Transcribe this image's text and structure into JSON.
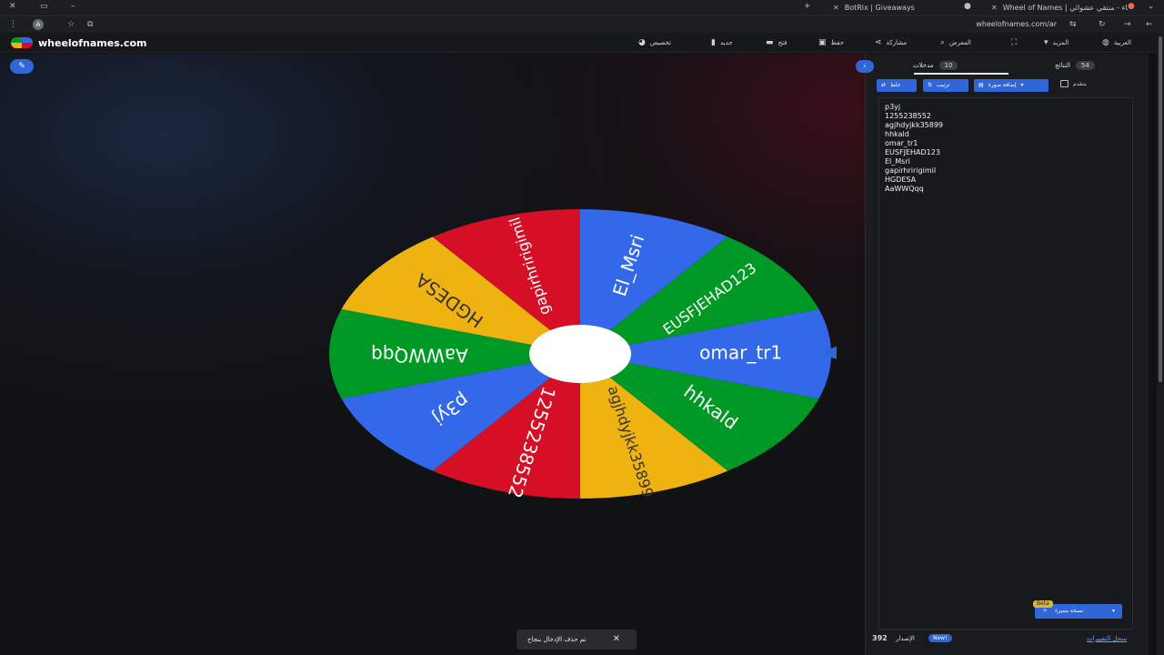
{
  "browser": {
    "tabs": [
      {
        "title": "Wheel of Names | عجلة الأسماء - منتقي عشوائي"
      },
      {
        "title": "BotRix | Giveaways"
      }
    ],
    "url": "wheelofnames.com/ar"
  },
  "site": {
    "name": "wheelofnames.com",
    "nav": [
      {
        "label": "العربية",
        "icon": "globe-icon"
      },
      {
        "label": "المزيد",
        "icon": "chevron-down-icon"
      },
      {
        "label": "",
        "icon": "fullscreen-icon"
      },
      {
        "label": "المعرض",
        "icon": "search-icon"
      },
      {
        "label": "مشاركة",
        "icon": "share-icon"
      },
      {
        "label": "حفظ",
        "icon": "save-icon"
      },
      {
        "label": "فتح",
        "icon": "folder-icon"
      },
      {
        "label": "جديد",
        "icon": "file-icon"
      },
      {
        "label": "تخصيص",
        "icon": "palette-icon"
      }
    ]
  },
  "wheel": {
    "entries": [
      "omar_tr1",
      "hhkald",
      "agjhdyjkk35899",
      "1255238552",
      "p3yj",
      "AaWWQqq",
      "HGDESA",
      "gapirhririgimil",
      "El_Msri",
      "EUSFJEHAD123"
    ],
    "colors": {
      "blue": "#3369e8",
      "green": "#009925",
      "yellow": "#eeb211",
      "red": "#d50f25"
    }
  },
  "toast": {
    "text": "تم حذف الإدخال بنجاح",
    "close": "✕"
  },
  "panel": {
    "tabs": {
      "entries_label": "مدخلات",
      "entries_count": "10",
      "results_label": "النتائج",
      "results_count": "54"
    },
    "tools": {
      "shuffle": "خلط",
      "sort": "ترتيب",
      "add_image": "إضافة صورة",
      "advanced": "متقدم"
    },
    "entries": [
      "p3yj",
      "1255238552",
      "agjhdyjkk35899",
      "hhkald",
      "omar_tr1",
      "EUSFJEHAD123",
      "El_Msri",
      "gapirhririgimil",
      "HGDESA",
      "AaWWQqq"
    ],
    "advanced_button": "نسخة مميزة",
    "beta": "Beta",
    "footer": {
      "version_label": "الإصدار",
      "version": "392",
      "new_badge": "New!",
      "changelog_link": "سجل التغييرات"
    }
  }
}
